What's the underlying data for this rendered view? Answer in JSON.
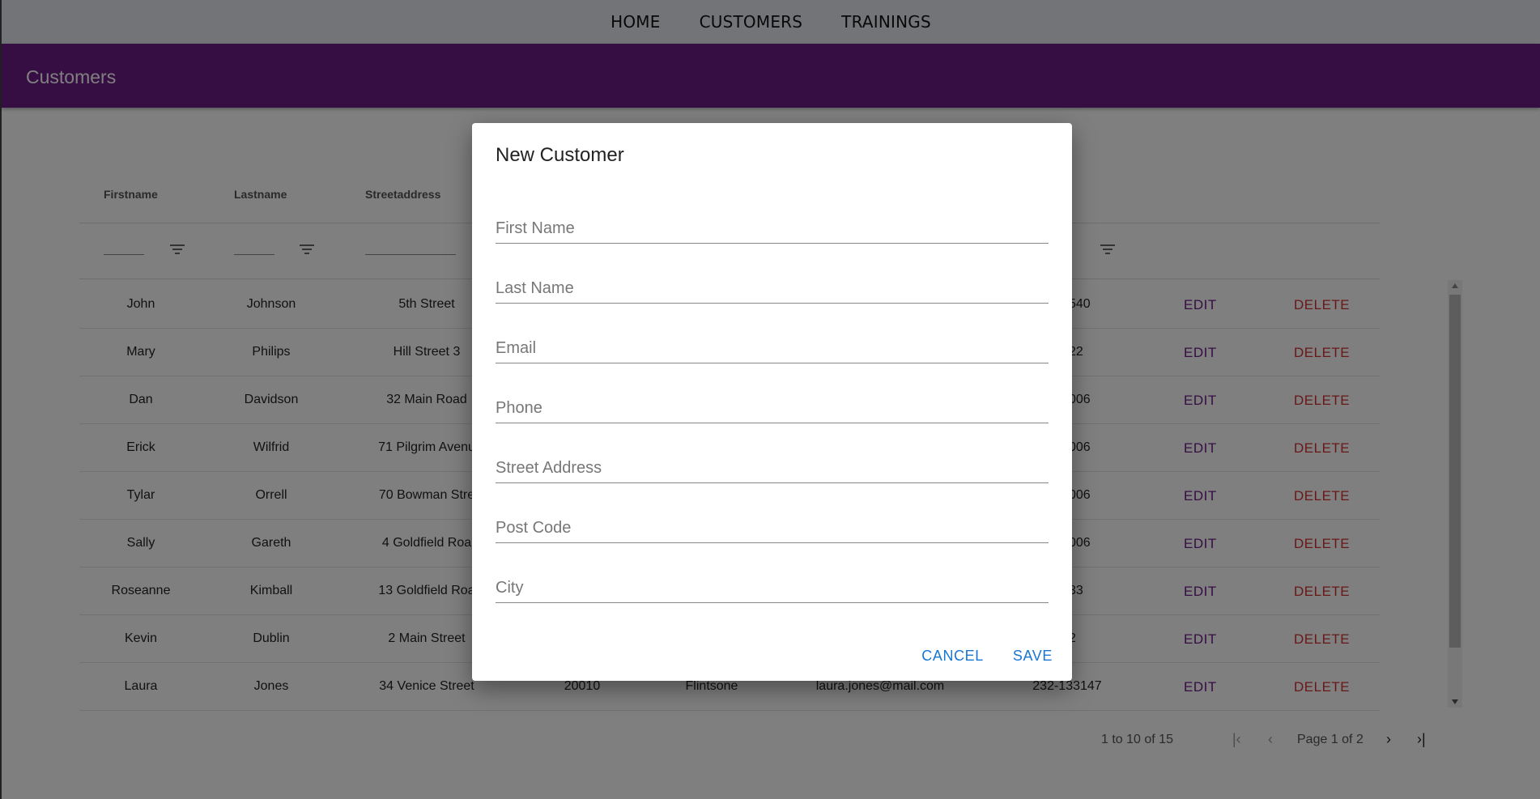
{
  "nav": {
    "links": [
      "HOME",
      "CUSTOMERS",
      "TRAININGS"
    ]
  },
  "appbar": {
    "title": "Customers"
  },
  "grid": {
    "columns": [
      "Firstname",
      "Lastname",
      "Streetaddress"
    ],
    "rows": [
      [
        "John",
        "Johnson",
        "5th Street",
        "",
        "",
        "",
        "540"
      ],
      [
        "Mary",
        "Philips",
        "Hill Street 3",
        "",
        "",
        "",
        "22"
      ],
      [
        "Dan",
        "Davidson",
        "32 Main Road",
        "",
        "",
        "",
        "006"
      ],
      [
        "Erick",
        "Wilfrid",
        "71 Pilgrim Avenu",
        "",
        "",
        "",
        "006"
      ],
      [
        "Tylar",
        "Orrell",
        "70 Bowman Stre",
        "",
        "",
        "",
        "006"
      ],
      [
        "Sally",
        "Gareth",
        "4 Goldfield Roa",
        "",
        "",
        "",
        "006"
      ],
      [
        "Roseanne",
        "Kimball",
        "13 Goldfield Roa",
        "",
        "",
        "",
        "33"
      ],
      [
        "Kevin",
        "Dublin",
        "2 Main Street",
        "",
        "",
        "",
        "2"
      ],
      [
        "Laura",
        "Jones",
        "34 Venice Street",
        "20010",
        "Flintsone",
        "laura.jones@mail.com",
        "232-133147"
      ]
    ],
    "edit_label": "EDIT",
    "delete_label": "DELETE"
  },
  "pagination": {
    "summary": "1 to 10 of 15",
    "first": "|‹",
    "prev": "‹",
    "page_info": "Page 1 of 2",
    "next": "›",
    "last": "›|"
  },
  "dialog": {
    "title": "New Customer",
    "fields": [
      {
        "placeholder": "First Name"
      },
      {
        "placeholder": "Last Name"
      },
      {
        "placeholder": "Email"
      },
      {
        "placeholder": "Phone"
      },
      {
        "placeholder": "Street Address"
      },
      {
        "placeholder": "Post Code"
      },
      {
        "placeholder": "City"
      }
    ],
    "cancel_label": "CANCEL",
    "save_label": "SAVE"
  }
}
